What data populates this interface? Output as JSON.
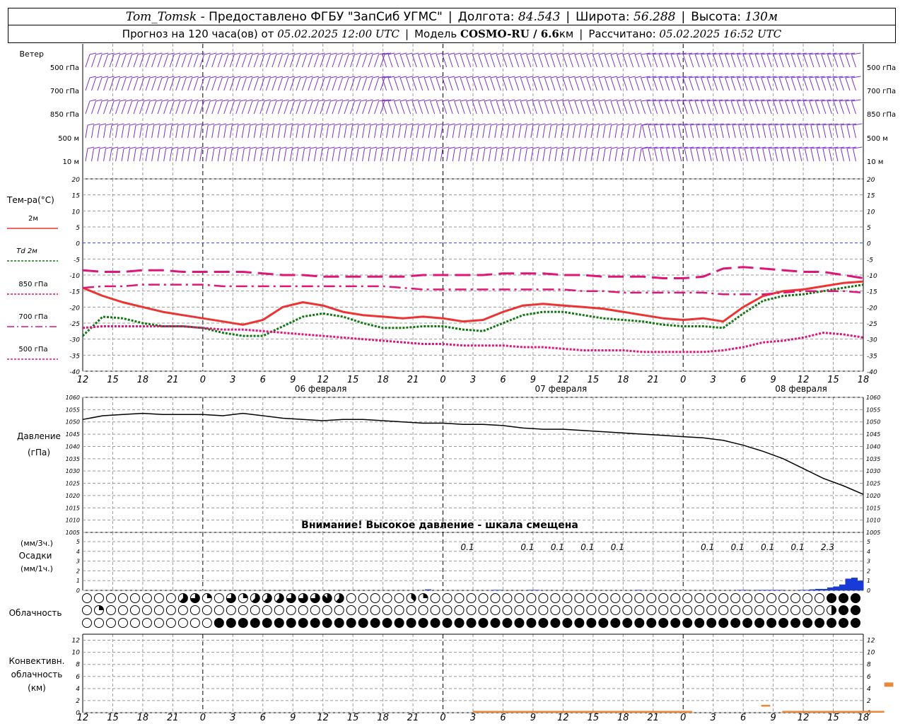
{
  "header": {
    "station": "Tom_Tomsk",
    "provider": "- Предоставлено ФГБУ \"ЗапСиб УГМС\"",
    "lon_label": "Долгота:",
    "lon": "84.543",
    "lat_label": "Широта:",
    "lat": "56.288",
    "alt_label": "Высота:",
    "alt": "130м",
    "forecast_label": "Прогноз на 120 часа(ов) от",
    "forecast_time": "05.02.2025 12:00 UTC",
    "model_label": "Модель",
    "model": "COSMO-RU / 6.6",
    "model_unit": "км",
    "calc_label": "Рассчитано:",
    "calc_time": "05.02.2025 16:52 UTC"
  },
  "colors": {
    "t2m": "#ee3333",
    "td2m": "#117711",
    "t850": "#e0157a",
    "t700": "#e0157a",
    "t500": "#e0157a",
    "wind": "#7b2fd0",
    "pressure": "#000000",
    "precip": "#1a3ad8",
    "convective": "#e8883a",
    "zero_line": "#2244ff",
    "grid": "#9a9a9a"
  },
  "labels": {
    "wind_title": "Ветер",
    "wind_levels": [
      "500 гПа",
      "700 гПа",
      "850 гПа",
      "500 м",
      "10 м"
    ],
    "temp_title": "Тем-ра(°С)",
    "legend": [
      "2м",
      "Td  2м",
      "850 гПа",
      "700 гПа",
      "500 гПа"
    ],
    "pressure_title": "Давление",
    "pressure_unit": "(гПа)",
    "pressure_warning": "Внимание! Высокое давление - шкала смещена",
    "precip_unit_top": "(мм/3ч.)",
    "precip_title": "Осадки",
    "precip_unit_bottom": "(мм/1ч.)",
    "cloud_title": "Облачность",
    "conv_title_1": "Конвективн.",
    "conv_title_2": "облачность",
    "conv_unit": "(км)"
  },
  "chart_data": {
    "type": "line",
    "x_hour_ticks": [
      "12",
      "15",
      "18",
      "21",
      "0",
      "3",
      "6",
      "9",
      "12",
      "15",
      "18",
      "21",
      "0",
      "3",
      "6",
      "9",
      "12",
      "15",
      "18",
      "21",
      "0",
      "3",
      "6",
      "9",
      "12",
      "15",
      "18"
    ],
    "date_labels": [
      "06 февраля",
      "07 февраля",
      "08 февраля"
    ],
    "temperature": {
      "ylim": [
        -40,
        20
      ],
      "yticks": [
        20,
        15,
        10,
        5,
        0,
        -5,
        -10,
        -15,
        -20,
        -25,
        -30,
        -35,
        -40
      ],
      "series": [
        {
          "name": "2м",
          "style": "solid",
          "values": [
            -14,
            -16.5,
            -18.5,
            -20,
            -21.5,
            -22.5,
            -23.5,
            -24.5,
            -25.5,
            -24,
            -20,
            -18.5,
            -19.5,
            -21.5,
            -22.5,
            -23,
            -23.5,
            -23,
            -23.5,
            -24.5,
            -24,
            -21.5,
            -19.5,
            -19,
            -19.5,
            -20,
            -20.5,
            -21.5,
            -22.5,
            -23.5,
            -24,
            -23.5,
            -24.5,
            -20,
            -16.5,
            -15,
            -14.5,
            -13.5,
            -12.5,
            -12
          ]
        },
        {
          "name": "Td  2м",
          "style": "dotted",
          "values": [
            -29,
            -23,
            -23.5,
            -25,
            -26,
            -26,
            -26.5,
            -28,
            -29,
            -29,
            -26,
            -23,
            -22,
            -23,
            -25,
            -26.5,
            -26.5,
            -26,
            -26,
            -27,
            -27.5,
            -25,
            -22.5,
            -21.5,
            -21.5,
            -22.5,
            -23.5,
            -24,
            -24.5,
            -25.5,
            -26,
            -26,
            -26.5,
            -22,
            -18,
            -16.5,
            -16,
            -15,
            -14,
            -13
          ]
        },
        {
          "name": "850 гПа",
          "style": "dash",
          "values": [
            -8.5,
            -9,
            -9,
            -8.5,
            -8.5,
            -9,
            -9,
            -9,
            -9,
            -9.5,
            -10,
            -10,
            -10.5,
            -10.5,
            -10.5,
            -10.5,
            -10.5,
            -10,
            -10,
            -10,
            -10,
            -9.5,
            -9.5,
            -9.5,
            -10,
            -10,
            -10.5,
            -10.5,
            -10.5,
            -11,
            -11,
            -10.5,
            -8,
            -7.5,
            -8,
            -8.5,
            -9,
            -9,
            -10,
            -11
          ]
        },
        {
          "name": "700 гПа",
          "style": "dashdot",
          "values": [
            -14,
            -13.5,
            -13.5,
            -13,
            -13,
            -13,
            -13,
            -13.5,
            -13.5,
            -13.5,
            -13.5,
            -13.5,
            -13.5,
            -13.5,
            -13.5,
            -13.5,
            -14,
            -14.5,
            -14.5,
            -14.5,
            -14.5,
            -14.5,
            -14.5,
            -14.5,
            -14.5,
            -15,
            -15,
            -15.5,
            -15.5,
            -15.5,
            -15.5,
            -15.5,
            -16,
            -16,
            -16,
            -15.5,
            -15,
            -15,
            -15,
            -15.5
          ]
        },
        {
          "name": "500 гПа",
          "style": "dotted",
          "values": [
            -26.5,
            -26,
            -26,
            -26,
            -26,
            -26,
            -26.5,
            -27,
            -27,
            -27.5,
            -28,
            -28.5,
            -29,
            -29.5,
            -30,
            -30.5,
            -31,
            -31.5,
            -31.5,
            -32,
            -32,
            -32,
            -32.5,
            -32.5,
            -33,
            -33.5,
            -33.5,
            -33.5,
            -34,
            -34,
            -34,
            -34,
            -33.5,
            -32.5,
            -31,
            -30.5,
            -29.5,
            -28,
            -28.5,
            -29.5
          ]
        }
      ]
    },
    "pressure": {
      "ylim": [
        1005,
        1060
      ],
      "yticks": [
        1060,
        1055,
        1050,
        1045,
        1040,
        1035,
        1030,
        1025,
        1020,
        1015,
        1010,
        1005
      ],
      "series": [
        {
          "name": "Давление",
          "values": [
            1051,
            1052.5,
            1053,
            1053.5,
            1053,
            1053,
            1053,
            1052.5,
            1053.5,
            1052.5,
            1051.5,
            1051,
            1050.5,
            1051,
            1051,
            1050.5,
            1050,
            1049.5,
            1049.5,
            1049,
            1049,
            1048.5,
            1047.5,
            1047,
            1047,
            1046.5,
            1046,
            1045.5,
            1045,
            1044.5,
            1044,
            1043.5,
            1042.5,
            1040.5,
            1038,
            1035,
            1031,
            1027,
            1024,
            1020.5
          ]
        }
      ]
    },
    "precipitation": {
      "yticks": [
        5,
        4,
        3,
        2,
        1,
        0
      ],
      "labels": [
        {
          "x_step": 13,
          "text": "0.1"
        },
        {
          "x_step": 15,
          "text": "0.1"
        },
        {
          "x_step": 16,
          "text": "0.1"
        },
        {
          "x_step": 17,
          "text": "0.1"
        },
        {
          "x_step": 18,
          "text": "0.1"
        },
        {
          "x_step": 21,
          "text": "0.1"
        },
        {
          "x_step": 22,
          "text": "0.1"
        },
        {
          "x_step": 23,
          "text": "0.1"
        },
        {
          "x_step": 24,
          "text": "0.1"
        },
        {
          "x_step": 25,
          "text": "2.3"
        }
      ],
      "hourly_mm": [
        0,
        0,
        0,
        0,
        0,
        0,
        0,
        0,
        0,
        0,
        0,
        0,
        0,
        0,
        0,
        0,
        0,
        0,
        0,
        0,
        0,
        0,
        0,
        0,
        0,
        0,
        0,
        0,
        0,
        0,
        0,
        0,
        0,
        0,
        0,
        0,
        0,
        0,
        0,
        0,
        0,
        0,
        0,
        0,
        0,
        0,
        0,
        0,
        0,
        0,
        0,
        0,
        0,
        0,
        0,
        0,
        0,
        0.1,
        0,
        0,
        0,
        0,
        0,
        0,
        0,
        0,
        0,
        0,
        0.05,
        0.05,
        0,
        0,
        0,
        0,
        0.05,
        0.05,
        0,
        0,
        0,
        0,
        0,
        0,
        0,
        0,
        0,
        0,
        0,
        0,
        0,
        0,
        0,
        0,
        0.05,
        0,
        0,
        0,
        0,
        0,
        0,
        0,
        0,
        0,
        0,
        0,
        0,
        0,
        0,
        0,
        0,
        0.05,
        0.05,
        0,
        0.05,
        0.05,
        0.05,
        0.05,
        0.05,
        0,
        0,
        0.05,
        0.05,
        0.1,
        0.15,
        0.15,
        0.3,
        0.4,
        0.6,
        1.2,
        1.3,
        1.0
      ]
    },
    "cloud_rows": [
      "0000000000000000000005565625506666255575625262566666775550000000000000035225000000000000000000000000000000000000000000000000000000000000000000000000000000000000000888888888",
      "0022000000000000000000000000000000000000000000000000000000000000000005000000000000000000000000000000000000000000000000000000000000000000000000000000000000000000047888888",
      "0000000000000000000000000000888888888888888888888888888888888888888888888888888888888888888888888888888888888888888888888888888888888888888888888888888888888888888888888"
    ],
    "convective": {
      "ylim": [
        0,
        13
      ],
      "yticks": [
        12,
        10,
        8,
        6,
        4,
        2,
        0
      ],
      "segments": [
        {
          "from_step": 13,
          "to_step": 20.3,
          "bottom_km": 0,
          "top_km": 0.3
        },
        {
          "from_step": 22.6,
          "to_step": 22.9,
          "bottom_km": 1,
          "top_km": 1.3
        },
        {
          "from_step": 23.3,
          "to_step": 26.7,
          "bottom_km": 0,
          "top_km": 0.3
        },
        {
          "from_step": 26.7,
          "to_step": 27,
          "bottom_km": 4.3,
          "top_km": 5
        }
      ]
    }
  }
}
